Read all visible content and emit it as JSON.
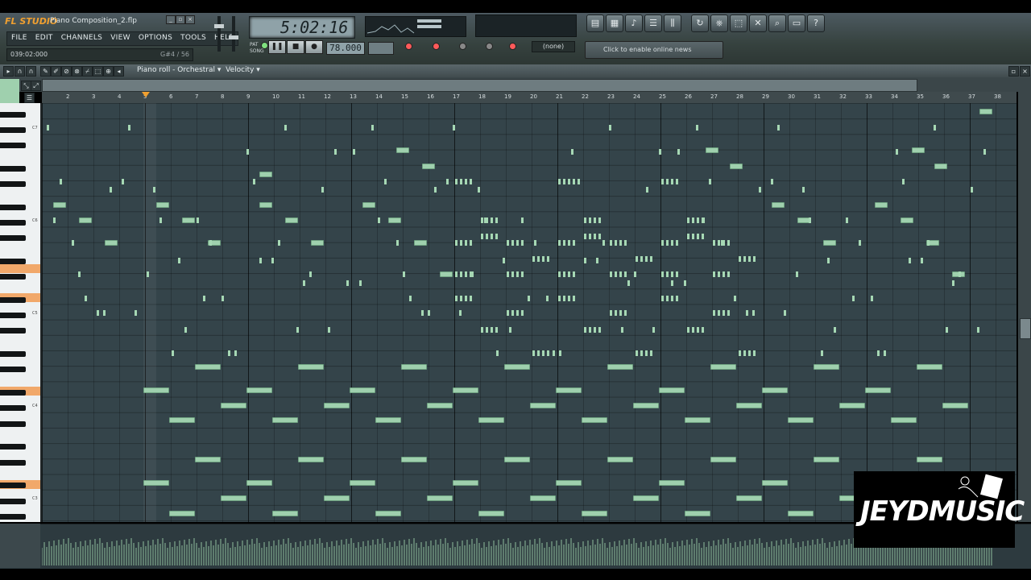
{
  "app": {
    "name": "FL STUDIO",
    "file": "Piano Composition_2.flp"
  },
  "menu": [
    "FILE",
    "EDIT",
    "CHANNELS",
    "VIEW",
    "OPTIONS",
    "TOOLS",
    "HELP"
  ],
  "hint": {
    "position": "039:02:000",
    "note": "G#4 / 56"
  },
  "transport": {
    "time": "5:02:16",
    "tempo": "78.000",
    "pattern_label": "PAT",
    "song_label": "SONG"
  },
  "output_none": "(none)",
  "news": "Click to enable online news",
  "pianoroll": {
    "title": "Piano roll - Orchestral",
    "target": "Velocity"
  },
  "ruler": [
    "2",
    "3",
    "4",
    "5",
    "6",
    "7",
    "8",
    "9",
    "10",
    "11",
    "12",
    "13",
    "14",
    "15",
    "16",
    "17",
    "18",
    "19",
    "20",
    "21",
    "22",
    "23",
    "24",
    "25",
    "26",
    "27",
    "28",
    "29",
    "30",
    "31",
    "32",
    "33",
    "34",
    "35",
    "36",
    "37",
    "38"
  ],
  "ruler_first_visible": "5",
  "octaves": [
    "C7",
    "C6",
    "C5",
    "C4",
    "C3"
  ],
  "watermark": "JEYDMUSIC",
  "colors": {
    "note": "#9fd0ae",
    "grid": "#34444a",
    "accent_key": "#f1a86a"
  }
}
